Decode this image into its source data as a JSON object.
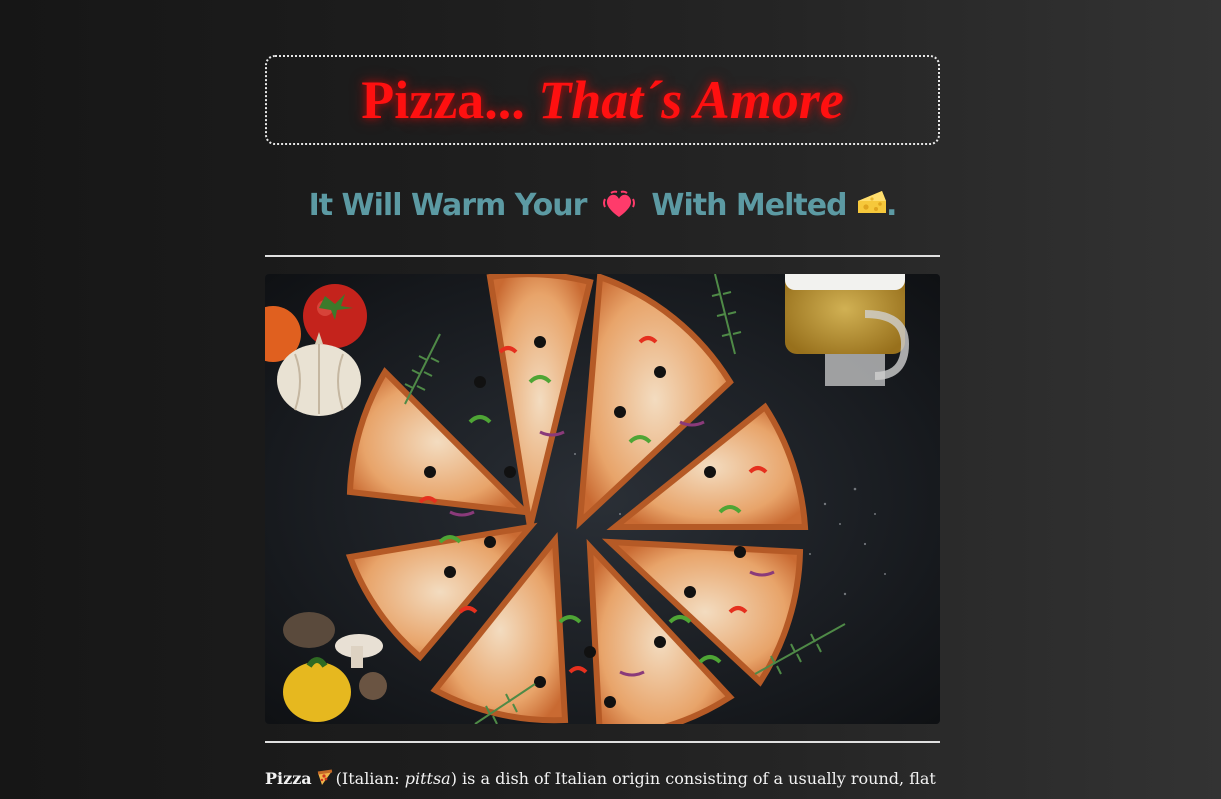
{
  "header": {
    "title_main": "Pizza...",
    "title_italic": "That´s Amore"
  },
  "subtitle": {
    "part1": "It Will Warm Your",
    "part2": "With Melted",
    "end": ".",
    "icons": [
      "heart-icon",
      "cheese-icon"
    ]
  },
  "hero_image": {
    "description_icons": [
      "pizza-icon",
      "beer-mug-icon",
      "tomato-icon",
      "garlic-icon",
      "mushroom-icon",
      "pepper-icon",
      "rosemary-icon"
    ]
  },
  "intro": {
    "bold": "Pizza",
    "paren_open": "(Italian: ",
    "italic": "pittsa",
    "rest": ") is a dish of Italian origin consisting of a usually round, flat"
  },
  "colors": {
    "title": "#ff1010",
    "subtitle": "#5c9aa3",
    "background_dark": "#161616",
    "background_light": "#333333",
    "rule": "#e0e0e0"
  }
}
